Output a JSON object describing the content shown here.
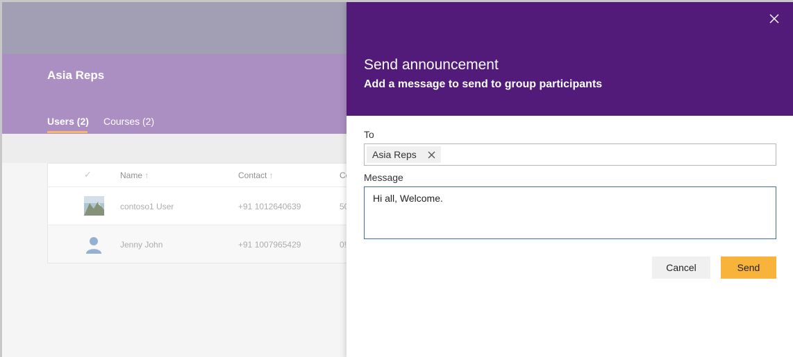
{
  "background": {
    "group_title": "Asia Reps",
    "tabs": [
      {
        "label": "Users (2)"
      },
      {
        "label": "Courses (2)"
      }
    ],
    "table": {
      "columns": [
        "Name",
        "Contact",
        "Co"
      ],
      "rows": [
        {
          "name": "contoso1 User",
          "contact": "+91 1012640639",
          "extra": "50"
        },
        {
          "name": "Jenny John",
          "contact": "+91 1007965429",
          "extra": "0!"
        }
      ]
    }
  },
  "panel": {
    "title": "Send announcement",
    "subtitle": "Add a message to send to group participants",
    "to_label": "To",
    "to_chip": "Asia Reps",
    "message_label": "Message",
    "message_value": "Hi all, Welcome.",
    "cancel_label": "Cancel",
    "send_label": "Send"
  },
  "colors": {
    "header": "#521b7a",
    "banner": "#9a77b5",
    "send": "#f7b33a"
  }
}
